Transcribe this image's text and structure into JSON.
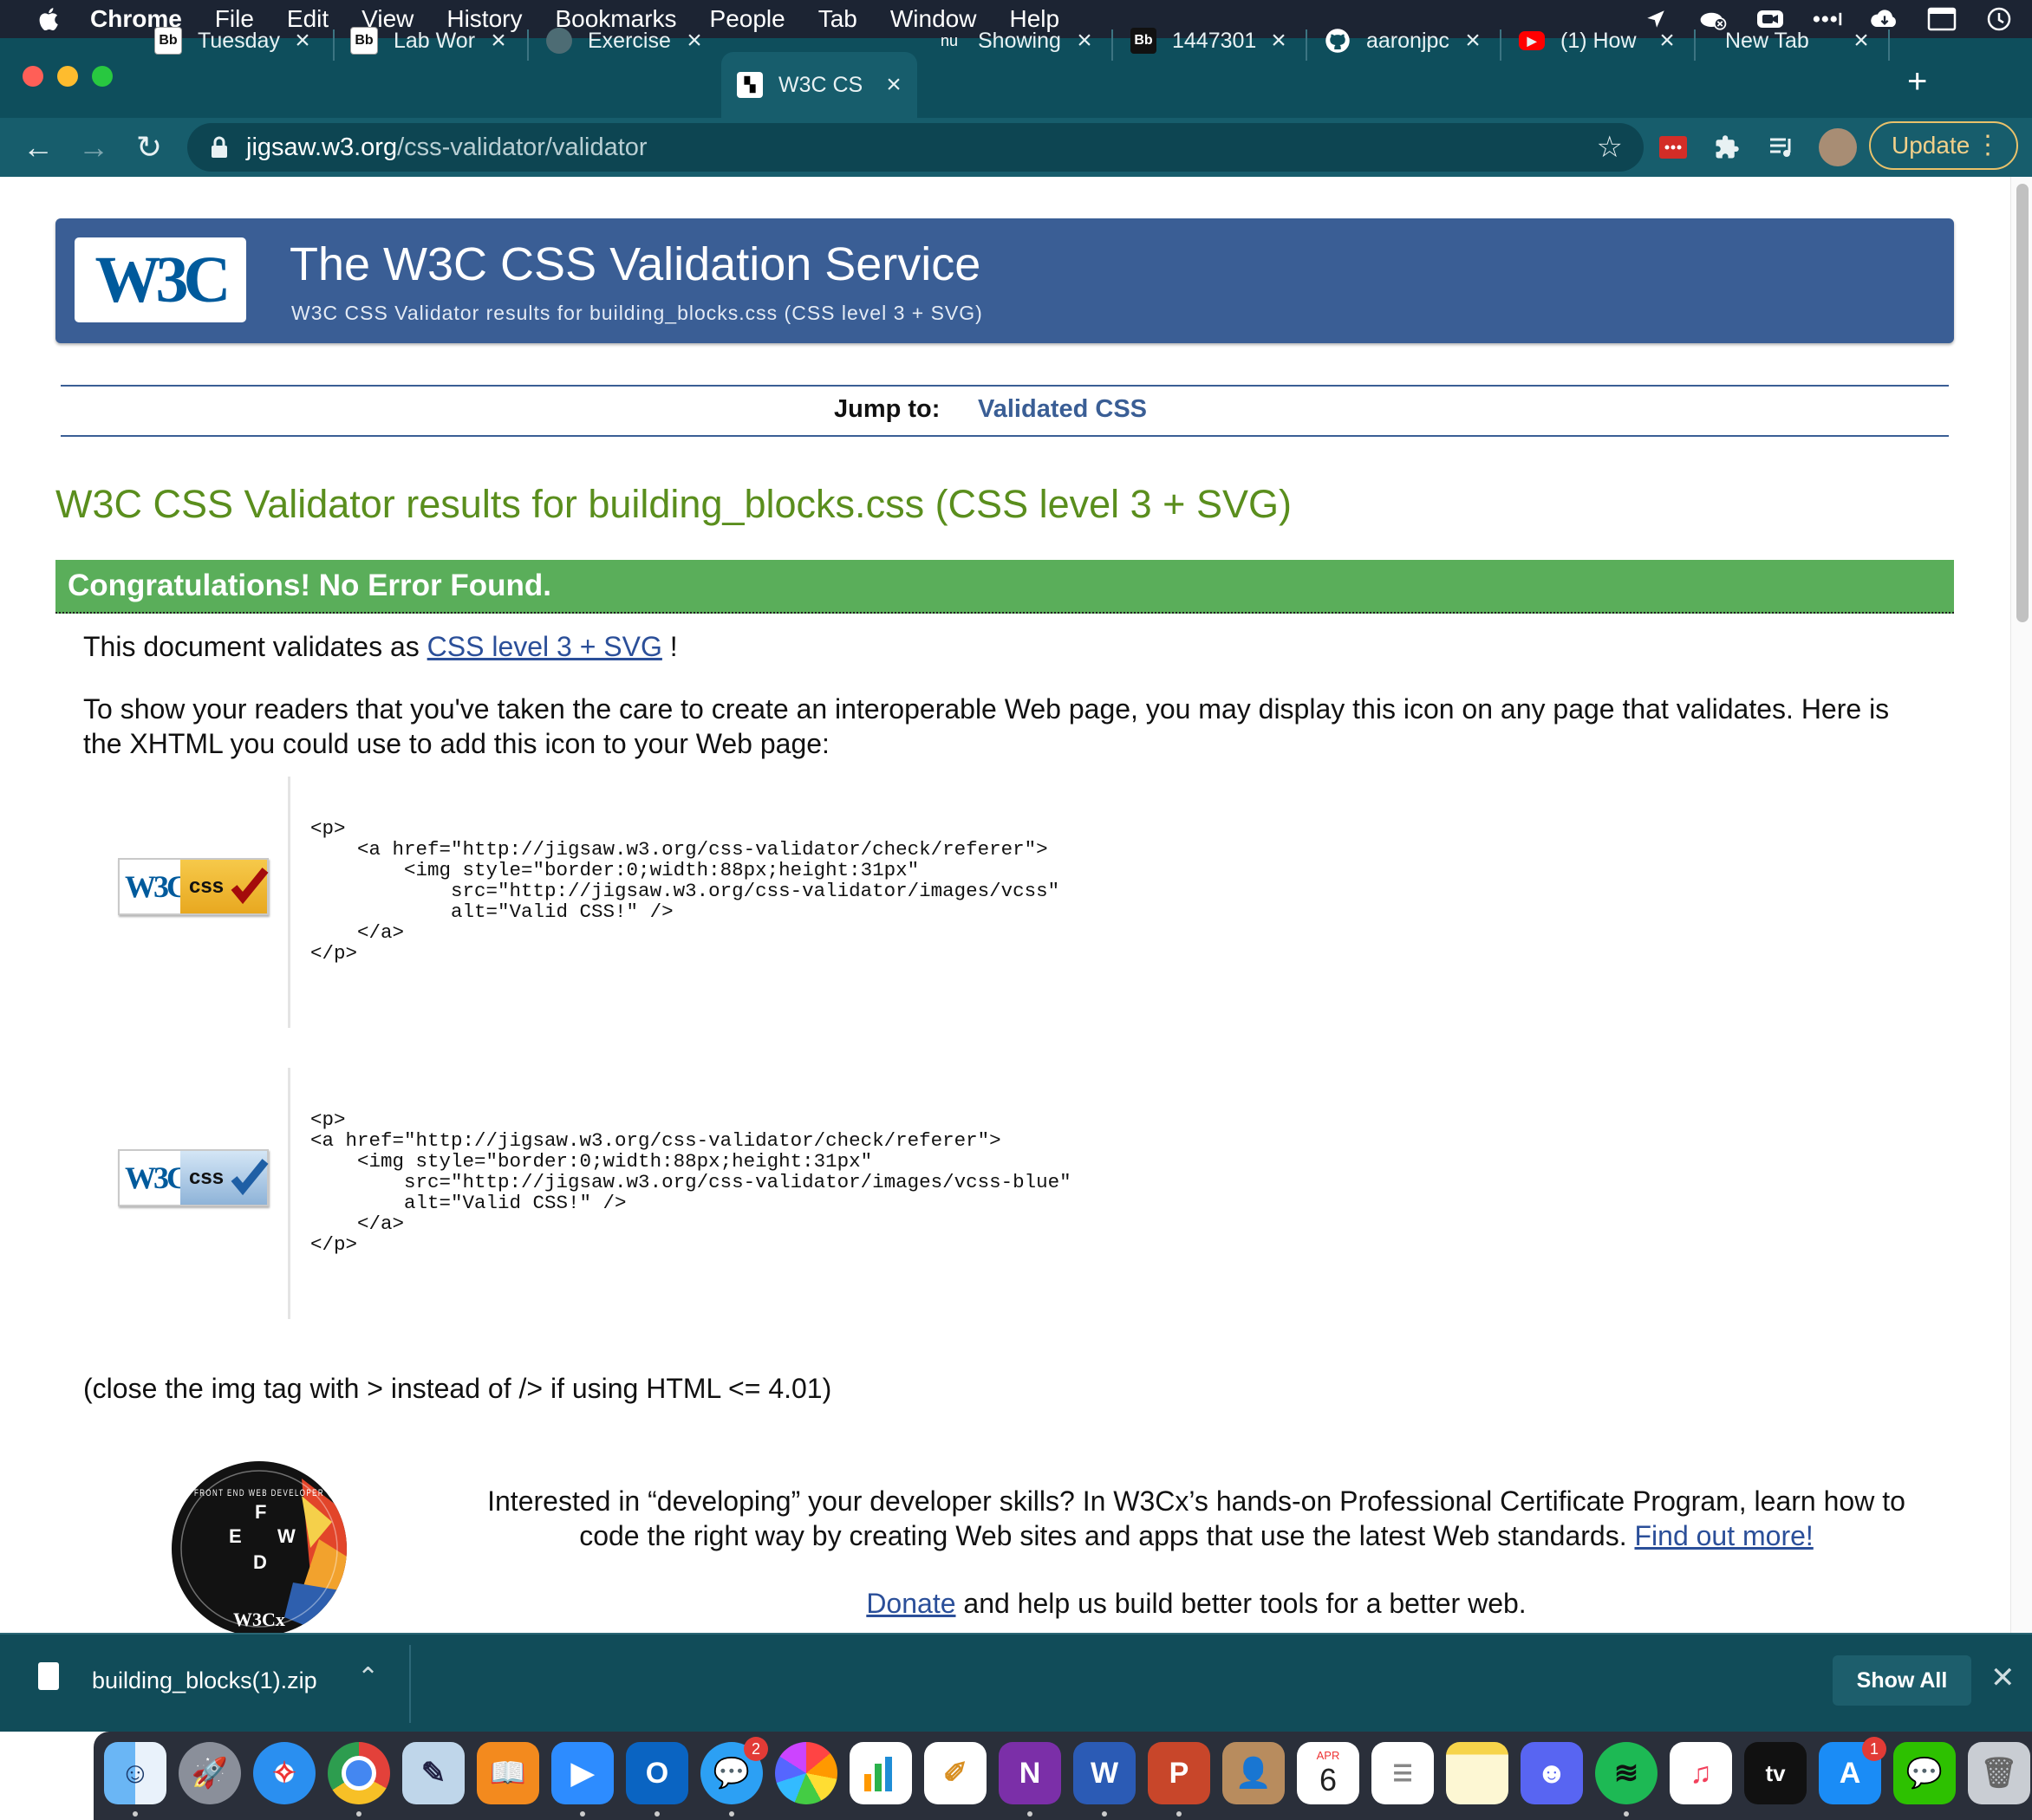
{
  "menubar": {
    "app": "Chrome",
    "items": [
      "File",
      "Edit",
      "View",
      "History",
      "Bookmarks",
      "People",
      "Tab",
      "Window",
      "Help"
    ],
    "right_icons": [
      "location-icon",
      "creative-cloud-icon",
      "zoom-icon",
      "more-icon",
      "cloud-icon",
      "display-icon",
      "time-machine-icon"
    ]
  },
  "tabs": [
    {
      "label": "Tuesday",
      "favicon": "Bb"
    },
    {
      "label": "Lab Wor",
      "favicon": "Bb"
    },
    {
      "label": "Exercise",
      "favicon": "globe"
    },
    {
      "label": "W3C CS",
      "favicon": "w3c",
      "active": true
    },
    {
      "label": "Showing",
      "favicon": "nu"
    },
    {
      "label": "1447301",
      "favicon": "Bb"
    },
    {
      "label": "aaronjpc",
      "favicon": "github"
    },
    {
      "label": "(1) How",
      "favicon": "youtube"
    },
    {
      "label": "New Tab",
      "favicon": ""
    }
  ],
  "toolbar": {
    "url_host": "jigsaw.w3.org",
    "url_path": "/css-validator/validator",
    "update_label": "Update"
  },
  "page": {
    "banner_title": "The W3C CSS Validation Service",
    "banner_subtitle": "W3C CSS Validator results for building_blocks.css (CSS level 3 + SVG)",
    "logo_text": "W3C",
    "jump_label": "Jump to:",
    "jump_link": "Validated CSS",
    "results_heading": "W3C CSS Validator results for building_blocks.css (CSS level 3 + SVG)",
    "congrats": "Congratulations! No Error Found.",
    "validates_prefix": "This document validates as ",
    "validates_link": "CSS level 3 + SVG",
    "validates_suffix": " !",
    "icon_para": "To show your readers that you've taken the care to create an interoperable Web page, you may display this icon on any page that validates. Here is the XHTML you could use to add this icon to your Web page:",
    "badge1": {
      "w3c": "W3C",
      "css": "css"
    },
    "badge2": {
      "w3c": "W3C",
      "css": "css"
    },
    "code1": "<p>\n    <a href=\"http://jigsaw.w3.org/css-validator/check/referer\">\n        <img style=\"border:0;width:88px;height:31px\"\n            src=\"http://jigsaw.w3.org/css-validator/images/vcss\"\n            alt=\"Valid CSS!\" />\n    </a>\n</p>",
    "code2": "<p>\n<a href=\"http://jigsaw.w3.org/css-validator/check/referer\">\n    <img style=\"border:0;width:88px;height:31px\"\n        src=\"http://jigsaw.w3.org/css-validator/images/vcss-blue\"\n        alt=\"Valid CSS!\" />\n    </a>\n</p>",
    "close_note": "(close the img tag with > instead of /> if using HTML <= 4.01)",
    "promo_text": "Interested in “developing” your developer skills? In W3Cx’s hands-on Professional Certificate Program, learn how to code the right way by creating Web sites and apps that use the latest Web standards. ",
    "promo_link": "Find out more!",
    "donate_link": "Donate",
    "donate_text": " and help us build better tools for a better web.",
    "w3cx_badge": {
      "ring": "FRONT END WEB DEVELOPER",
      "letters": [
        "F",
        "E",
        "W",
        "D"
      ],
      "brand": "W3Cx"
    }
  },
  "download_shelf": {
    "filename": "building_blocks(1).zip",
    "show_all": "Show All"
  },
  "dock": {
    "calendar_month": "APR",
    "calendar_day": "6",
    "messages_badge": "2",
    "appstore_badge": "1",
    "apps": [
      "finder",
      "launchpad",
      "safari",
      "chrome",
      "preview",
      "books",
      "zoom",
      "outlook",
      "messages",
      "photos",
      "numbers",
      "script-editor",
      "onenote",
      "word",
      "powerpoint",
      "contacts",
      "calendar",
      "reminders",
      "notes",
      "discord",
      "spotify",
      "music",
      "tv",
      "app-store",
      "wechat",
      "trash"
    ]
  },
  "colors": {
    "banner": "#3a5e95",
    "congrats": "#5aae5a",
    "heading_green": "#5a8e1d",
    "link": "#2b4f99",
    "tab_bar": "#0e4e5c",
    "toolbar": "#175d6c"
  }
}
